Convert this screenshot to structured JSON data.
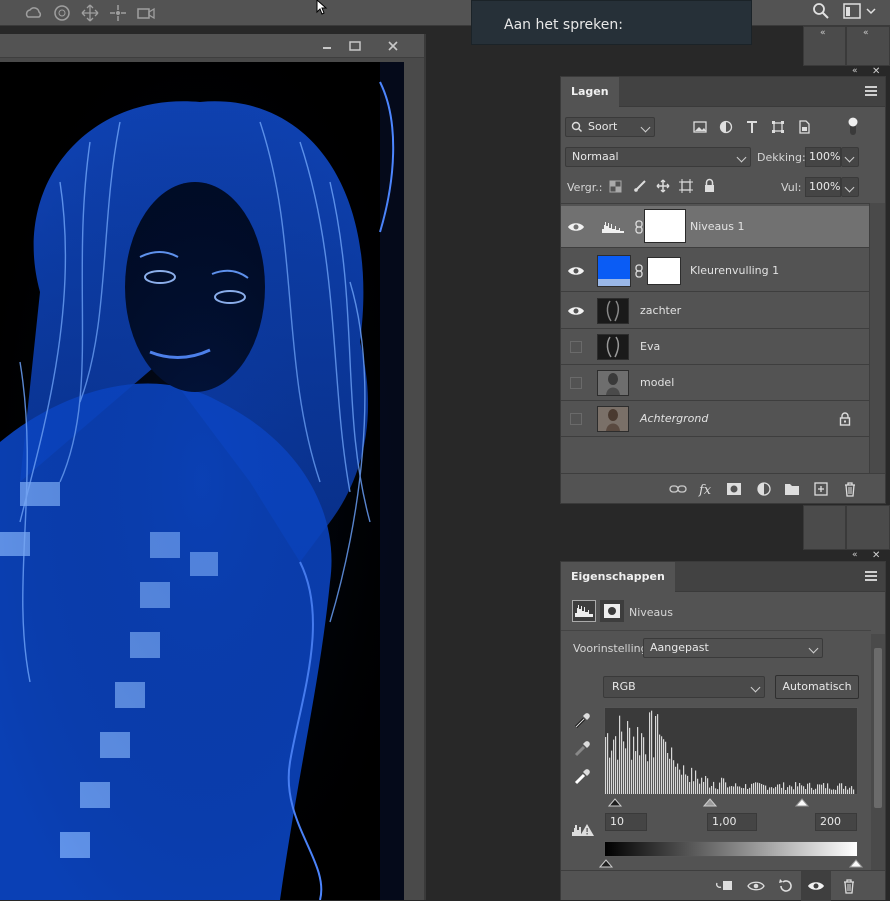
{
  "tooltip": {
    "text": "Aan het spreken:"
  },
  "layers_panel": {
    "tab": "Lagen",
    "filter": {
      "value": "Soort"
    },
    "blend_mode": "Normaal",
    "opacity_label": "Dekking:",
    "opacity_value": "100%",
    "lock_label": "Vergr.:",
    "fill_label": "Vul:",
    "fill_value": "100%",
    "layers": [
      {
        "name": "Niveaus 1",
        "visible": true,
        "selected": true,
        "italic": false
      },
      {
        "name": "Kleurenvulling 1",
        "visible": true,
        "selected": false,
        "italic": false,
        "fill_color": "#0a5cf5"
      },
      {
        "name": "zachter",
        "visible": true,
        "selected": false,
        "italic": false
      },
      {
        "name": "Eva",
        "visible": false,
        "selected": false,
        "italic": false
      },
      {
        "name": "model",
        "visible": false,
        "selected": false,
        "italic": false
      },
      {
        "name": "Achtergrond",
        "visible": false,
        "selected": false,
        "italic": true,
        "locked": true
      }
    ],
    "footer_icons": [
      "link-icon",
      "fx-icon",
      "mask-icon",
      "adjustment-icon",
      "folder-icon",
      "new-layer-icon",
      "trash-icon"
    ]
  },
  "properties_panel": {
    "tab": "Eigenschappen",
    "title": "Niveaus",
    "preset_label": "Voorinstelling:",
    "preset_value": "Aangepast",
    "channel": "RGB",
    "auto_button": "Automatisch",
    "input_black": "10",
    "input_gamma": "1,00",
    "input_white": "200",
    "histogram_accent": "#e8e8e8"
  },
  "canvas": {
    "accent": "#1f6dff",
    "background": "#000000"
  }
}
